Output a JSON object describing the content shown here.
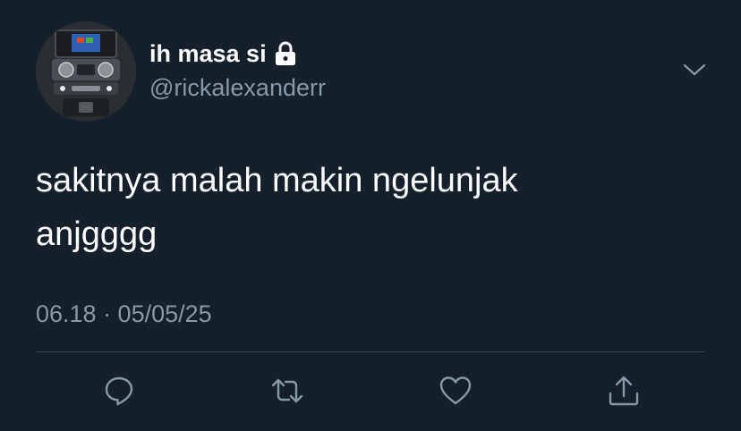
{
  "tweet": {
    "display_name": "ih masa si",
    "handle": "@rickalexanderr",
    "text": "sakitnya malah makin ngelunjak\nanjgggg",
    "timestamp": "06.18 · 05/05/25"
  },
  "icons": {
    "verified_lock": "lock-icon",
    "menu": "chevron-down-icon",
    "reply": "reply-icon",
    "retweet": "retweet-icon",
    "like": "heart-icon",
    "share": "share-icon"
  },
  "colors": {
    "background": "#15202b",
    "primary_text": "#ffffff",
    "secondary_text": "#8899a6",
    "divider": "#38444d"
  }
}
